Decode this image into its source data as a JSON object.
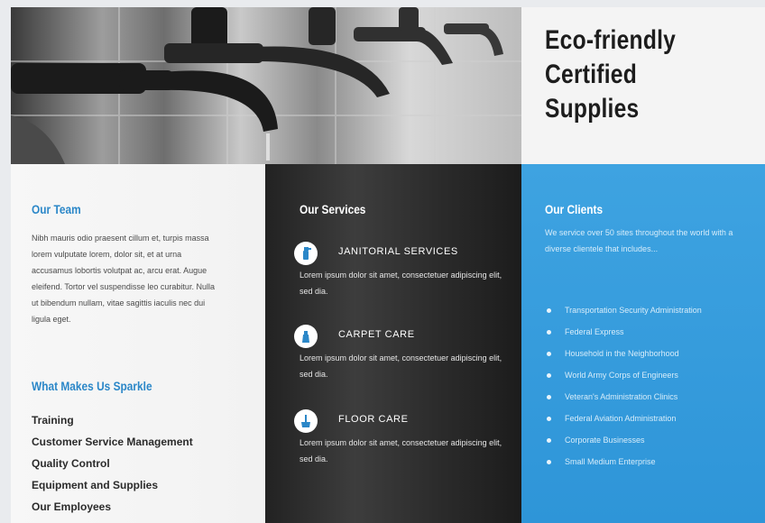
{
  "header": {
    "title_lines": [
      "Eco-friendly",
      "Certified",
      "Supplies"
    ]
  },
  "team": {
    "heading": "Our Team",
    "body": "Nibh mauris odio praesent cillum et, turpis massa lorem vulputate lorem, dolor sit, et at urna accusamus lobortis volutpat ac, arcu erat. Augue eleifend. Tortor vel suspendisse leo curabitur. Nulla ut bibendum nullam, vitae sagittis iaculis nec dui ligula eget."
  },
  "sparkle": {
    "heading": "What Makes Us Sparkle",
    "items": [
      "Training",
      "Customer Service Management",
      "Quality Control",
      "Equipment and Supplies",
      "Our Employees"
    ]
  },
  "services": {
    "heading": "Our Services",
    "items": [
      {
        "title": "JANITORIAL SERVICES",
        "icon": "spray-bottle-icon",
        "desc": "Lorem ipsum dolor sit amet, consectetuer adipiscing elit, sed dia."
      },
      {
        "title": "CARPET CARE",
        "icon": "cleaner-bottle-icon",
        "desc": "Lorem ipsum dolor sit amet, consectetuer adipiscing elit, sed dia."
      },
      {
        "title": "FLOOR CARE",
        "icon": "mop-bucket-icon",
        "desc": "Lorem ipsum dolor sit amet, consectetuer adipiscing elit, sed dia."
      }
    ]
  },
  "clients": {
    "heading": "Our Clients",
    "intro": "We service over 50 sites throughout the world with a diverse clientele that includes...",
    "items": [
      "Transportation Security Administration",
      "Federal Express",
      "Household in the Neighborhood",
      "World Army Corps of Engineers",
      "Veteran's Administration Clinics",
      "Federal Aviation Administration",
      "Corporate Businesses",
      "Small Medium Enterprise"
    ]
  },
  "colors": {
    "accent_blue": "#2e95d8",
    "heading_blue": "#2b87c8",
    "dark_panel": "#2a2a2a"
  }
}
